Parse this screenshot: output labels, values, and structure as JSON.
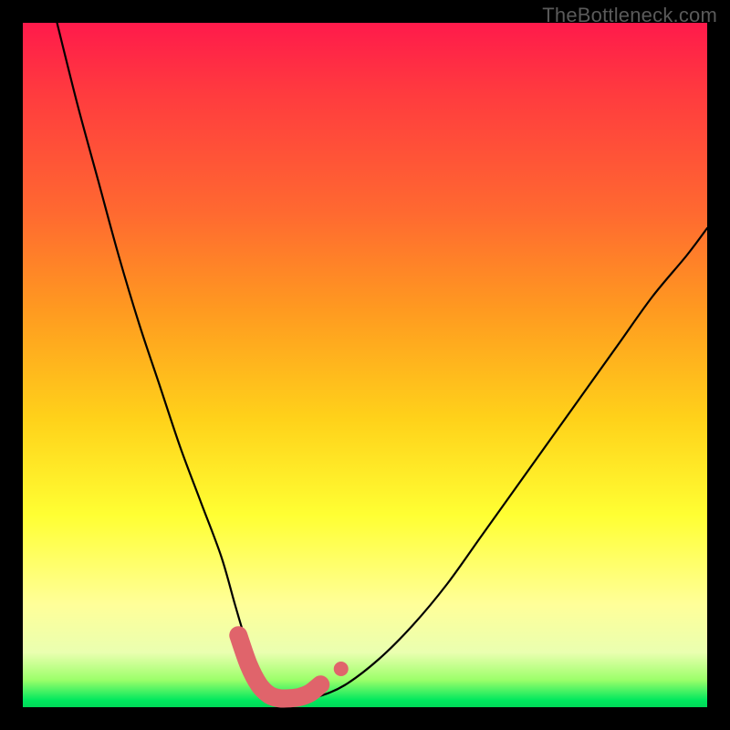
{
  "watermark": "TheBottleneck.com",
  "chart_data": {
    "type": "line",
    "title": "",
    "xlabel": "",
    "ylabel": "",
    "xlim": [
      0,
      100
    ],
    "ylim": [
      0,
      100
    ],
    "grid": false,
    "legend": false,
    "series": [
      {
        "name": "curve",
        "color": "#000000",
        "x": [
          5,
          8,
          11,
          14,
          17,
          20,
          23,
          26,
          29,
          31,
          32.5,
          34,
          35,
          36,
          37,
          38,
          40,
          43,
          47,
          52,
          57,
          62,
          67,
          72,
          77,
          82,
          87,
          92,
          97,
          100
        ],
        "y": [
          100,
          88,
          77,
          66,
          56,
          47,
          38,
          30,
          22,
          15,
          10,
          6,
          3.5,
          2,
          1.3,
          1.0,
          1.0,
          1.5,
          3.2,
          7,
          12,
          18,
          25,
          32,
          39,
          46,
          53,
          60,
          66,
          70
        ]
      },
      {
        "name": "highlight-bottom",
        "color": "#e0646b",
        "style": "thick-rounded",
        "x": [
          31.5,
          33,
          34.5,
          36,
          37.5,
          39,
          40.5,
          42,
          43.5
        ],
        "y": [
          10.5,
          6.2,
          3.3,
          1.8,
          1.3,
          1.3,
          1.5,
          2.1,
          3.3
        ]
      },
      {
        "name": "highlight-dot",
        "color": "#e0646b",
        "style": "dot",
        "x": [
          46.5
        ],
        "y": [
          5.6
        ]
      }
    ]
  }
}
